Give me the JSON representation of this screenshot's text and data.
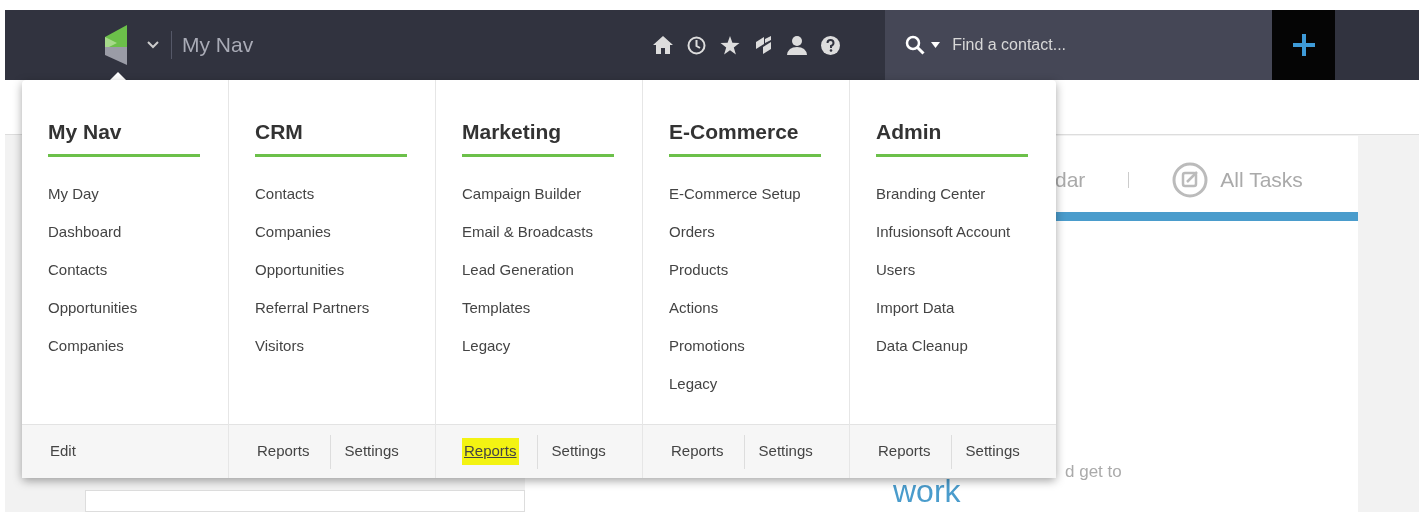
{
  "topbar": {
    "nav_title": "My Nav",
    "search": {
      "placeholder": "Find a contact..."
    }
  },
  "menu": {
    "columns": [
      {
        "title": "My Nav",
        "items": [
          "My Day",
          "Dashboard",
          "Contacts",
          "Opportunities",
          "Companies"
        ],
        "footer": [
          {
            "label": "Edit",
            "highlighted": false
          }
        ]
      },
      {
        "title": "CRM",
        "items": [
          "Contacts",
          "Companies",
          "Opportunities",
          "Referral Partners",
          "Visitors"
        ],
        "footer": [
          {
            "label": "Reports",
            "highlighted": false
          },
          {
            "label": "Settings",
            "highlighted": false
          }
        ]
      },
      {
        "title": "Marketing",
        "items": [
          "Campaign Builder",
          "Email & Broadcasts",
          "Lead Generation",
          "Templates",
          "Legacy"
        ],
        "footer": [
          {
            "label": "Reports",
            "highlighted": true
          },
          {
            "label": "Settings",
            "highlighted": false
          }
        ]
      },
      {
        "title": "E-Commerce",
        "items": [
          "E-Commerce Setup",
          "Orders",
          "Products",
          "Actions",
          "Promotions",
          "Legacy"
        ],
        "footer": [
          {
            "label": "Reports",
            "highlighted": false
          },
          {
            "label": "Settings",
            "highlighted": false
          }
        ]
      },
      {
        "title": "Admin",
        "items": [
          "Branding Center",
          "Infusionsoft Account",
          "Users",
          "Import Data",
          "Data Cleanup"
        ],
        "footer": [
          {
            "label": "Reports",
            "highlighted": false
          },
          {
            "label": "Settings",
            "highlighted": false
          }
        ]
      }
    ]
  },
  "background": {
    "tabs": [
      "dar",
      "All Tasks"
    ],
    "text": "d get to",
    "heading": "work"
  }
}
